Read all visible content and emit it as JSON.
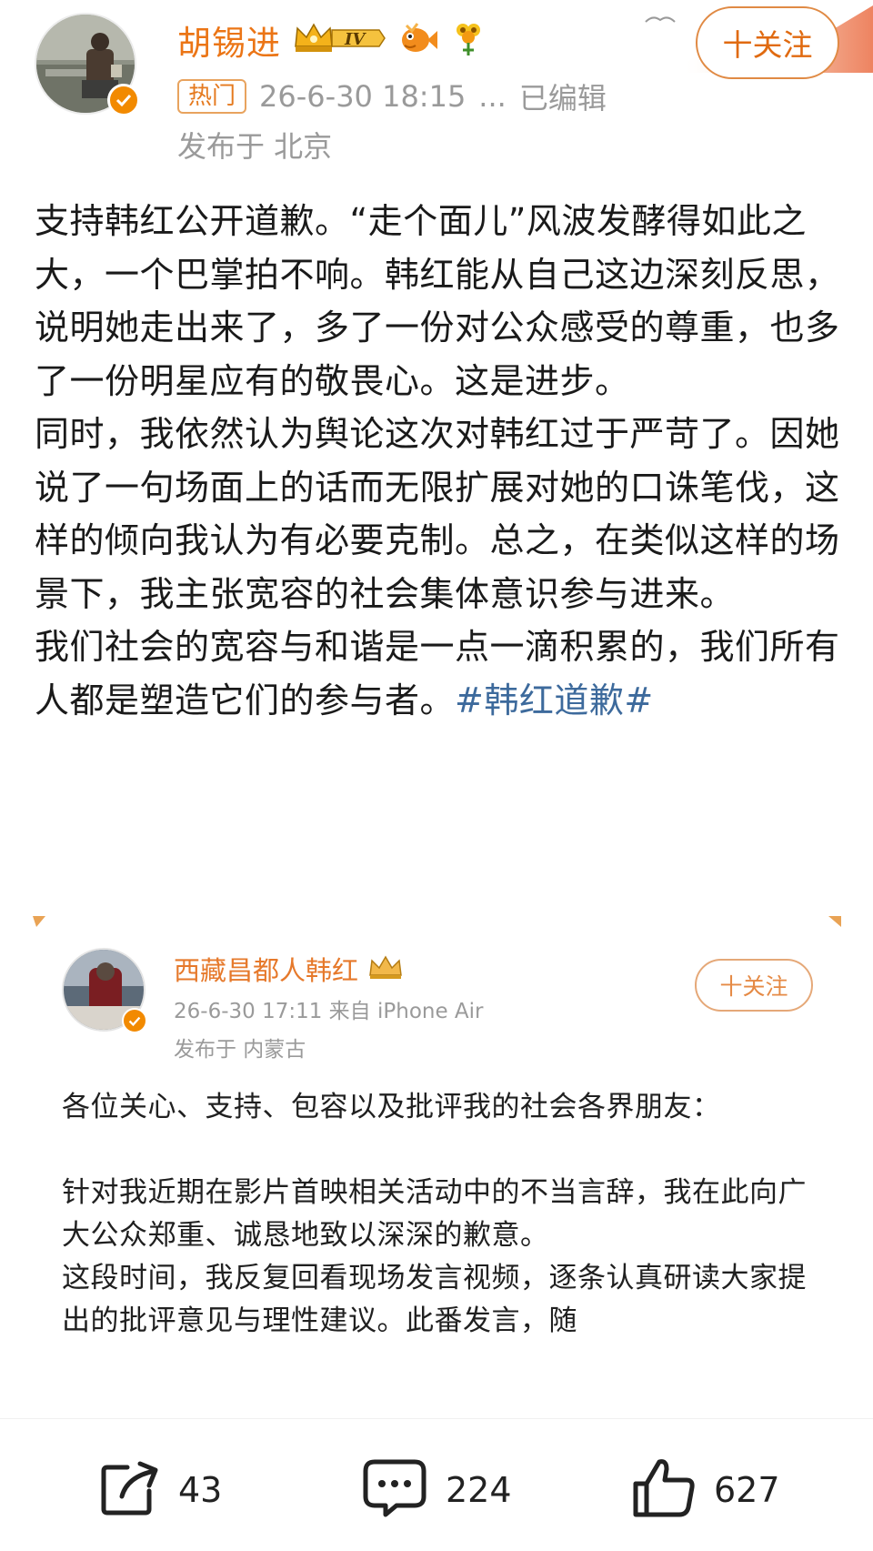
{
  "post": {
    "author": {
      "name": "胡锡进",
      "avatar_caption": "胡锡进 19",
      "level_badge": "IV"
    },
    "hot_label": "热门",
    "timestamp": "26-6-30 18:15",
    "more": "...",
    "edited": "已编辑",
    "location": "发布于 北京",
    "follow_button": "十关注",
    "body": {
      "p1": "支持韩红公开道歉。“走个面儿”风波发酵得如此之大，一个巴掌拍不响。韩红能从自己这边深刻反思，说明她走出来了，多了一份对公众感受的尊重，也多了一份明星应有的敬畏心。这是进步。",
      "p2": "同时，我依然认为舆论这次对韩红过于严苛了。因她说了一句场面上的话而无限扩展对她的口诛笔伐，这样的倾向我认为有必要克制。总之，在类似这样的场景下，我主张宽容的社会集体意识参与进来。",
      "p3_text": "我们社会的宽容与和谐是一点一滴积累的，我们所有人都是塑造它们的参与者。",
      "hashtag": "#韩红道歉#"
    }
  },
  "quoted": {
    "author_name": "西藏昌都人韩红",
    "meta": "26-6-30 17:11  来自 iPhone Air",
    "location": "发布于 内蒙古",
    "follow_button": "十关注",
    "p1": "各位关心、支持、包容以及批评我的社会各界朋友：",
    "p2": "针对我近期在影片首映相关活动中的不当言辞，我在此向广大公众郑重、诚恳地致以深深的歉意。",
    "p3": "这段时间，我反复回看现场发言视频，逐条认真研读大家提出的批评意见与理性建议。此番发言，随"
  },
  "actions": {
    "repost": {
      "icon": "share-icon",
      "count": "43"
    },
    "comment": {
      "icon": "comment-icon",
      "count": "224"
    },
    "like": {
      "icon": "thumbs-up-icon",
      "count": "627"
    }
  },
  "colors": {
    "accent_orange": "#eb7516",
    "hashtag_blue": "#3d6a9c",
    "meta_gray": "#9a9a9a"
  }
}
